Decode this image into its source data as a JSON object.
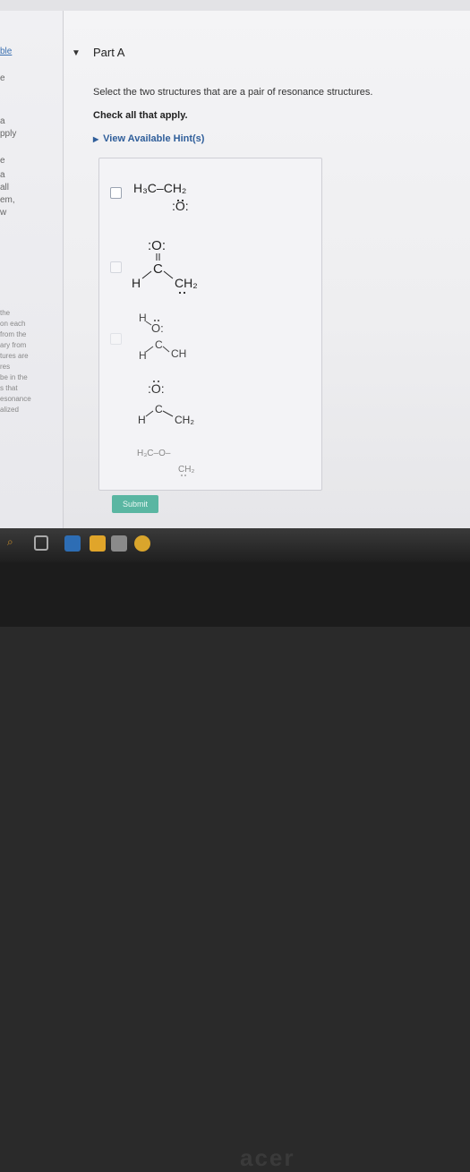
{
  "sidebar": {
    "items": [
      "ble",
      "e",
      "a",
      "pply",
      "e",
      "a",
      "all",
      "em,",
      "w",
      "the",
      "on each",
      "from the",
      "ary from",
      "tures are",
      "res",
      "be in the",
      "s that",
      "esonance",
      "alized"
    ]
  },
  "part": {
    "title": "Part A",
    "caret_icon": "caret-down-icon"
  },
  "question": {
    "instruction": "Select the two structures that are a pair of resonance structures.",
    "check_all": "Check all that apply.",
    "hint_label": "View Available Hint(s)"
  },
  "structures": [
    {
      "row1": "H₃C–CH₂",
      "oxygen": ":O:"
    },
    {
      "oxygen": ":O:",
      "carbon": "C",
      "h": "H",
      "ch": "CH₂"
    },
    {
      "h_top": "H",
      "oxygen": "O:",
      "carbon": "C",
      "h": "H",
      "ch": "CH"
    },
    {
      "oxygen": ":O:",
      "carbon": "C",
      "h": "H",
      "ch": "CH₂"
    },
    {
      "row1": "H₃C–O–",
      "ch": "CH₂"
    }
  ],
  "submit_label": "Submit",
  "brand": "acer"
}
